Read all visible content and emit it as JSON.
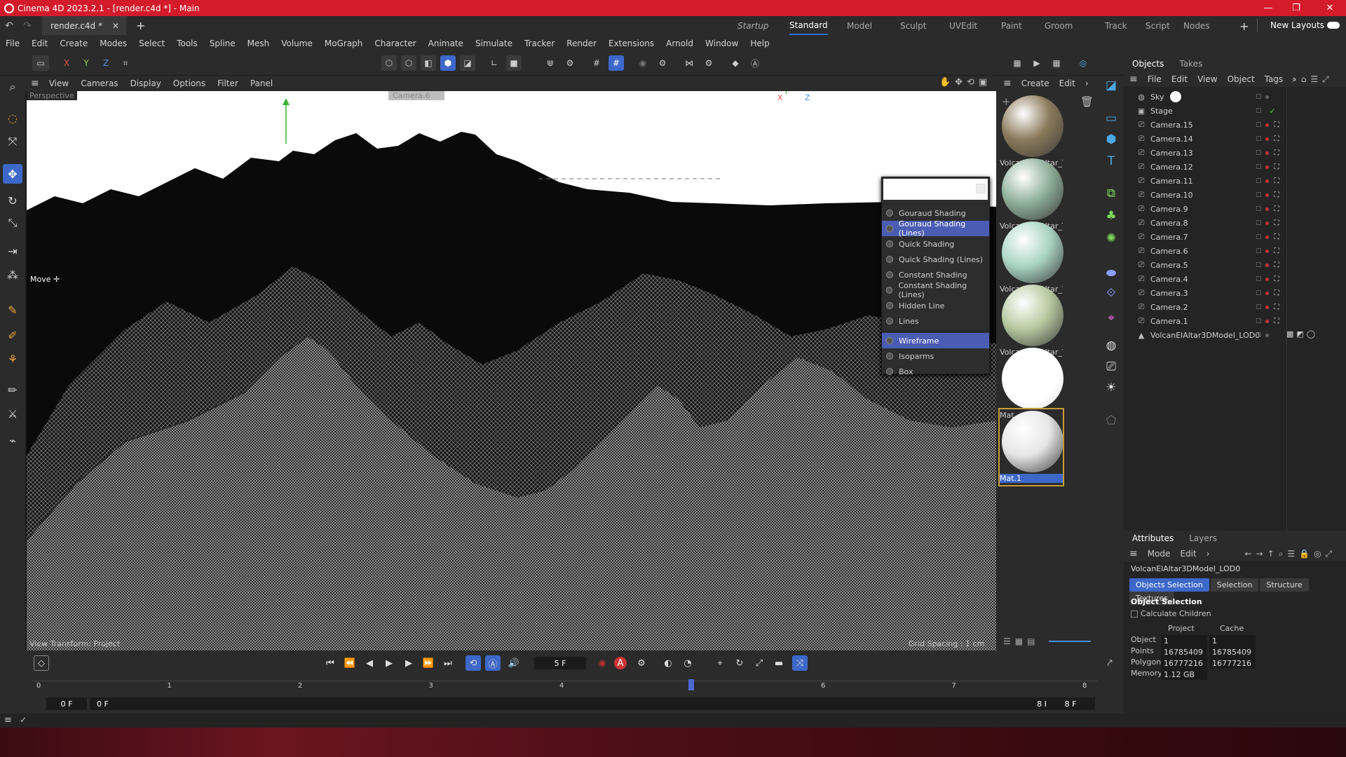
{
  "window": {
    "title": "Cinema 4D 2023.2.1 - [render.c4d *] - Main"
  },
  "tabs": {
    "file": "render.c4d *",
    "close": "✕",
    "new": "+"
  },
  "layouts": {
    "items": [
      "Startup",
      "Standard",
      "Model",
      "Sculpt",
      "UVEdit",
      "Paint",
      "Groom",
      "Track",
      "Script",
      "Nodes"
    ],
    "active": "Standard",
    "new_layouts": "New Layouts"
  },
  "menu": [
    "File",
    "Edit",
    "Create",
    "Modes",
    "Select",
    "Tools",
    "Spline",
    "Mesh",
    "Volume",
    "MoGraph",
    "Character",
    "Animate",
    "Simulate",
    "Tracker",
    "Render",
    "Extensions",
    "Arnold",
    "Window",
    "Help"
  ],
  "toolbar": {
    "x": "X",
    "y": "Y",
    "z": "Z"
  },
  "viewport": {
    "menu": [
      "View",
      "Cameras",
      "Display",
      "Options",
      "Filter",
      "Panel"
    ],
    "label": "Perspective",
    "camera": "Camera.6",
    "tool_label": "Move",
    "transform": "View Transform: Project",
    "grid": "Grid Spacing : 1 cm",
    "axis_y": "Y",
    "axis_x": "X",
    "axis_z": "Z"
  },
  "shading_menu": {
    "items": [
      {
        "label": "Gouraud Shading",
        "selected": false
      },
      {
        "label": "Gouraud Shading (Lines)",
        "selected": true
      },
      {
        "label": "Quick Shading",
        "selected": false
      },
      {
        "label": "Quick Shading (Lines)",
        "selected": false
      },
      {
        "label": "Constant Shading",
        "selected": false
      },
      {
        "label": "Constant Shading (Lines)",
        "selected": false
      },
      {
        "label": "Hidden Line",
        "selected": false
      },
      {
        "label": "Lines",
        "selected": false
      }
    ],
    "wire_items": [
      {
        "label": "Wireframe",
        "selected": true
      },
      {
        "label": "Isoparms",
        "selected": false
      },
      {
        "label": "Box",
        "selected": false
      }
    ]
  },
  "materials": {
    "menu": [
      "Create",
      "Edit"
    ],
    "items": [
      {
        "label": "Volcan_El_Altar_Te",
        "color": "#8a7a5a"
      },
      {
        "label": "Volcan_El_Altar_Te",
        "color": "#8fb09a"
      },
      {
        "label": "Volcan_El_Altar_Te",
        "color": "#a9d4c4"
      },
      {
        "label": "Volcan_El_Altar_Te",
        "color": "#b7c9a0"
      },
      {
        "label": "Mat",
        "color": "#ffffff"
      },
      {
        "label": "Mat.1",
        "color": "#e6e6e6"
      }
    ]
  },
  "objects": {
    "tabs": [
      "Objects",
      "Takes"
    ],
    "menu": [
      "File",
      "Edit",
      "View",
      "Object",
      "Tags"
    ],
    "items": [
      "Sky",
      "Stage",
      "Camera.15",
      "Camera.14",
      "Camera.13",
      "Camera.12",
      "Camera.11",
      "Camera.10",
      "Camera.9",
      "Camera.8",
      "Camera.7",
      "Camera.6",
      "Camera.5",
      "Camera.4",
      "Camera.3",
      "Camera.2",
      "Camera.1",
      "VolcanElAltar3DModel_LOD0"
    ]
  },
  "attributes": {
    "tabs": [
      "Attributes",
      "Layers"
    ],
    "menu": [
      "Mode",
      "Edit"
    ],
    "object_name": "VolcanElAltar3DModel_LOD0",
    "sub_tabs": [
      "Objects Selection",
      "Selection",
      "Structure",
      "Textures"
    ],
    "section": "Object Selection",
    "checkbox": "Calculate Children",
    "col_project": "Project",
    "col_cache": "Cache",
    "rows": [
      {
        "label": "Object",
        "project": "1",
        "cache": "1"
      },
      {
        "label": "Points",
        "project": "16785409",
        "cache": "16785409"
      },
      {
        "label": "Polygons",
        "project": "16777216",
        "cache": "16777216"
      },
      {
        "label": "Memory",
        "project": "1.12 GB",
        "cache": ""
      }
    ]
  },
  "timeline": {
    "frame": "5 F",
    "start": "0 F",
    "start2": "0 F",
    "end": "8 F",
    "end2": "8 F",
    "ticks": [
      "0",
      "1",
      "2",
      "3",
      "4",
      "5",
      "6",
      "7",
      "8"
    ],
    "current": 5
  }
}
